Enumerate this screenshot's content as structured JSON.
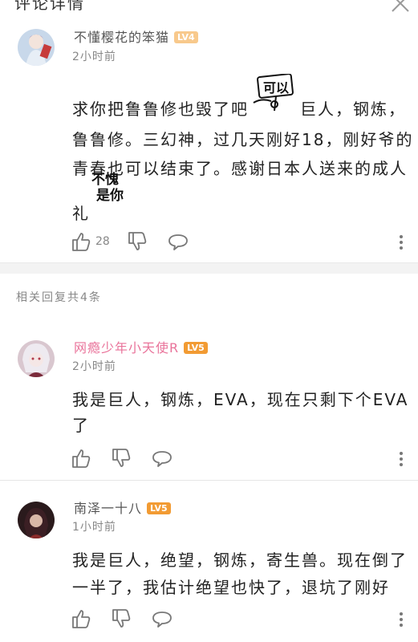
{
  "header": {
    "title": "评论详情"
  },
  "main_comment": {
    "username": "不懂樱花的笨猫",
    "level": "LV4",
    "time": "2小时前",
    "lines": [
      "求你把鲁鲁修也毁了吧",
      "巨人，钢炼，",
      "鲁鲁修。三幻神，过几天刚好18，刚好爷的",
      "青春也可以结束了。感谢日本人送来的成人",
      "礼"
    ],
    "stickers": {
      "sticker1": "可以",
      "sticker2_top": "不愧",
      "sticker2_bottom": "是你"
    },
    "likes": "28"
  },
  "replies_section": {
    "label": "相关回复共4条"
  },
  "replies": [
    {
      "username": "网瘾少年小天使R",
      "level": "LV5",
      "time": "2小时前",
      "lines": [
        "我是巨人，钢炼，EVA，现在只剩下个EVA",
        "了"
      ]
    },
    {
      "username": "南泽一十八",
      "level": "LV5",
      "time": "1小时前",
      "lines": [
        "我是巨人，绝望，钢炼，寄生兽。现在倒了",
        "一半了，我估计绝望也快了，退坑了刚好"
      ]
    }
  ],
  "icons": {
    "like": "thumbs-up-icon",
    "dislike": "thumbs-down-icon",
    "reply": "speech-bubble-icon",
    "more": "more-vertical-icon"
  },
  "colors": {
    "level_badge": "#f29b33",
    "pink_username": "#e9739a",
    "divider": "#f3f3f3"
  }
}
